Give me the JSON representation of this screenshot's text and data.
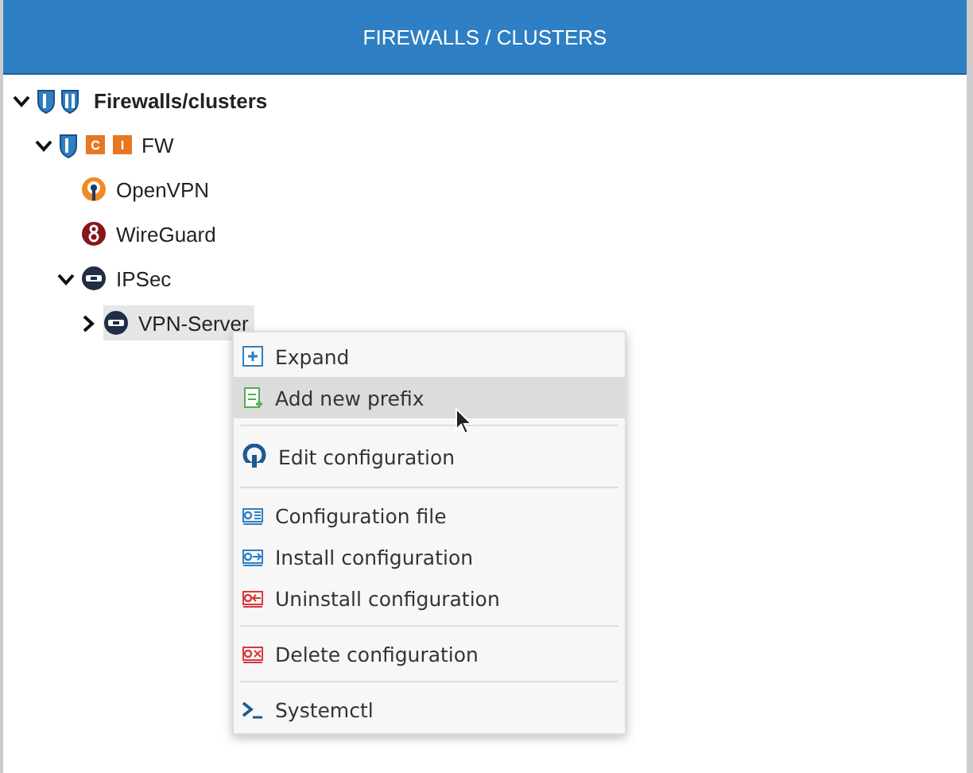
{
  "header": {
    "title": "FIREWALLS / CLUSTERS"
  },
  "tree": [
    {
      "label": "Firewalls/clusters",
      "kind": "root",
      "expanded": true,
      "selected": false,
      "children": [
        {
          "label": "FW",
          "kind": "firewall",
          "badges": [
            "C",
            "I"
          ],
          "expanded": true,
          "selected": false,
          "children": [
            {
              "label": "OpenVPN",
              "kind": "openvpn",
              "selected": false
            },
            {
              "label": "WireGuard",
              "kind": "wireguard",
              "selected": false
            },
            {
              "label": "IPSec",
              "kind": "ipsec",
              "expanded": true,
              "selected": false,
              "children": [
                {
                  "label": "VPN-Server",
                  "kind": "connection",
                  "expanded": false,
                  "selected": true
                }
              ]
            }
          ]
        }
      ]
    }
  ],
  "context_menu": {
    "groups": [
      [
        {
          "label": "Expand",
          "kind": "expand",
          "highlighted": false
        },
        {
          "label": "Add new prefix",
          "kind": "add",
          "highlighted": true
        }
      ],
      [
        {
          "label": "Edit configuration",
          "kind": "edit",
          "highlighted": false
        }
      ],
      [
        {
          "label": "Configuration file",
          "kind": "file",
          "highlighted": false
        },
        {
          "label": "Install configuration",
          "kind": "install",
          "highlighted": false
        },
        {
          "label": "Uninstall configuration",
          "kind": "uninstall",
          "highlighted": false
        }
      ],
      [
        {
          "label": "Delete configuration",
          "kind": "delete",
          "highlighted": false
        }
      ],
      [
        {
          "label": "Systemctl",
          "kind": "terminal",
          "highlighted": false
        }
      ]
    ]
  }
}
